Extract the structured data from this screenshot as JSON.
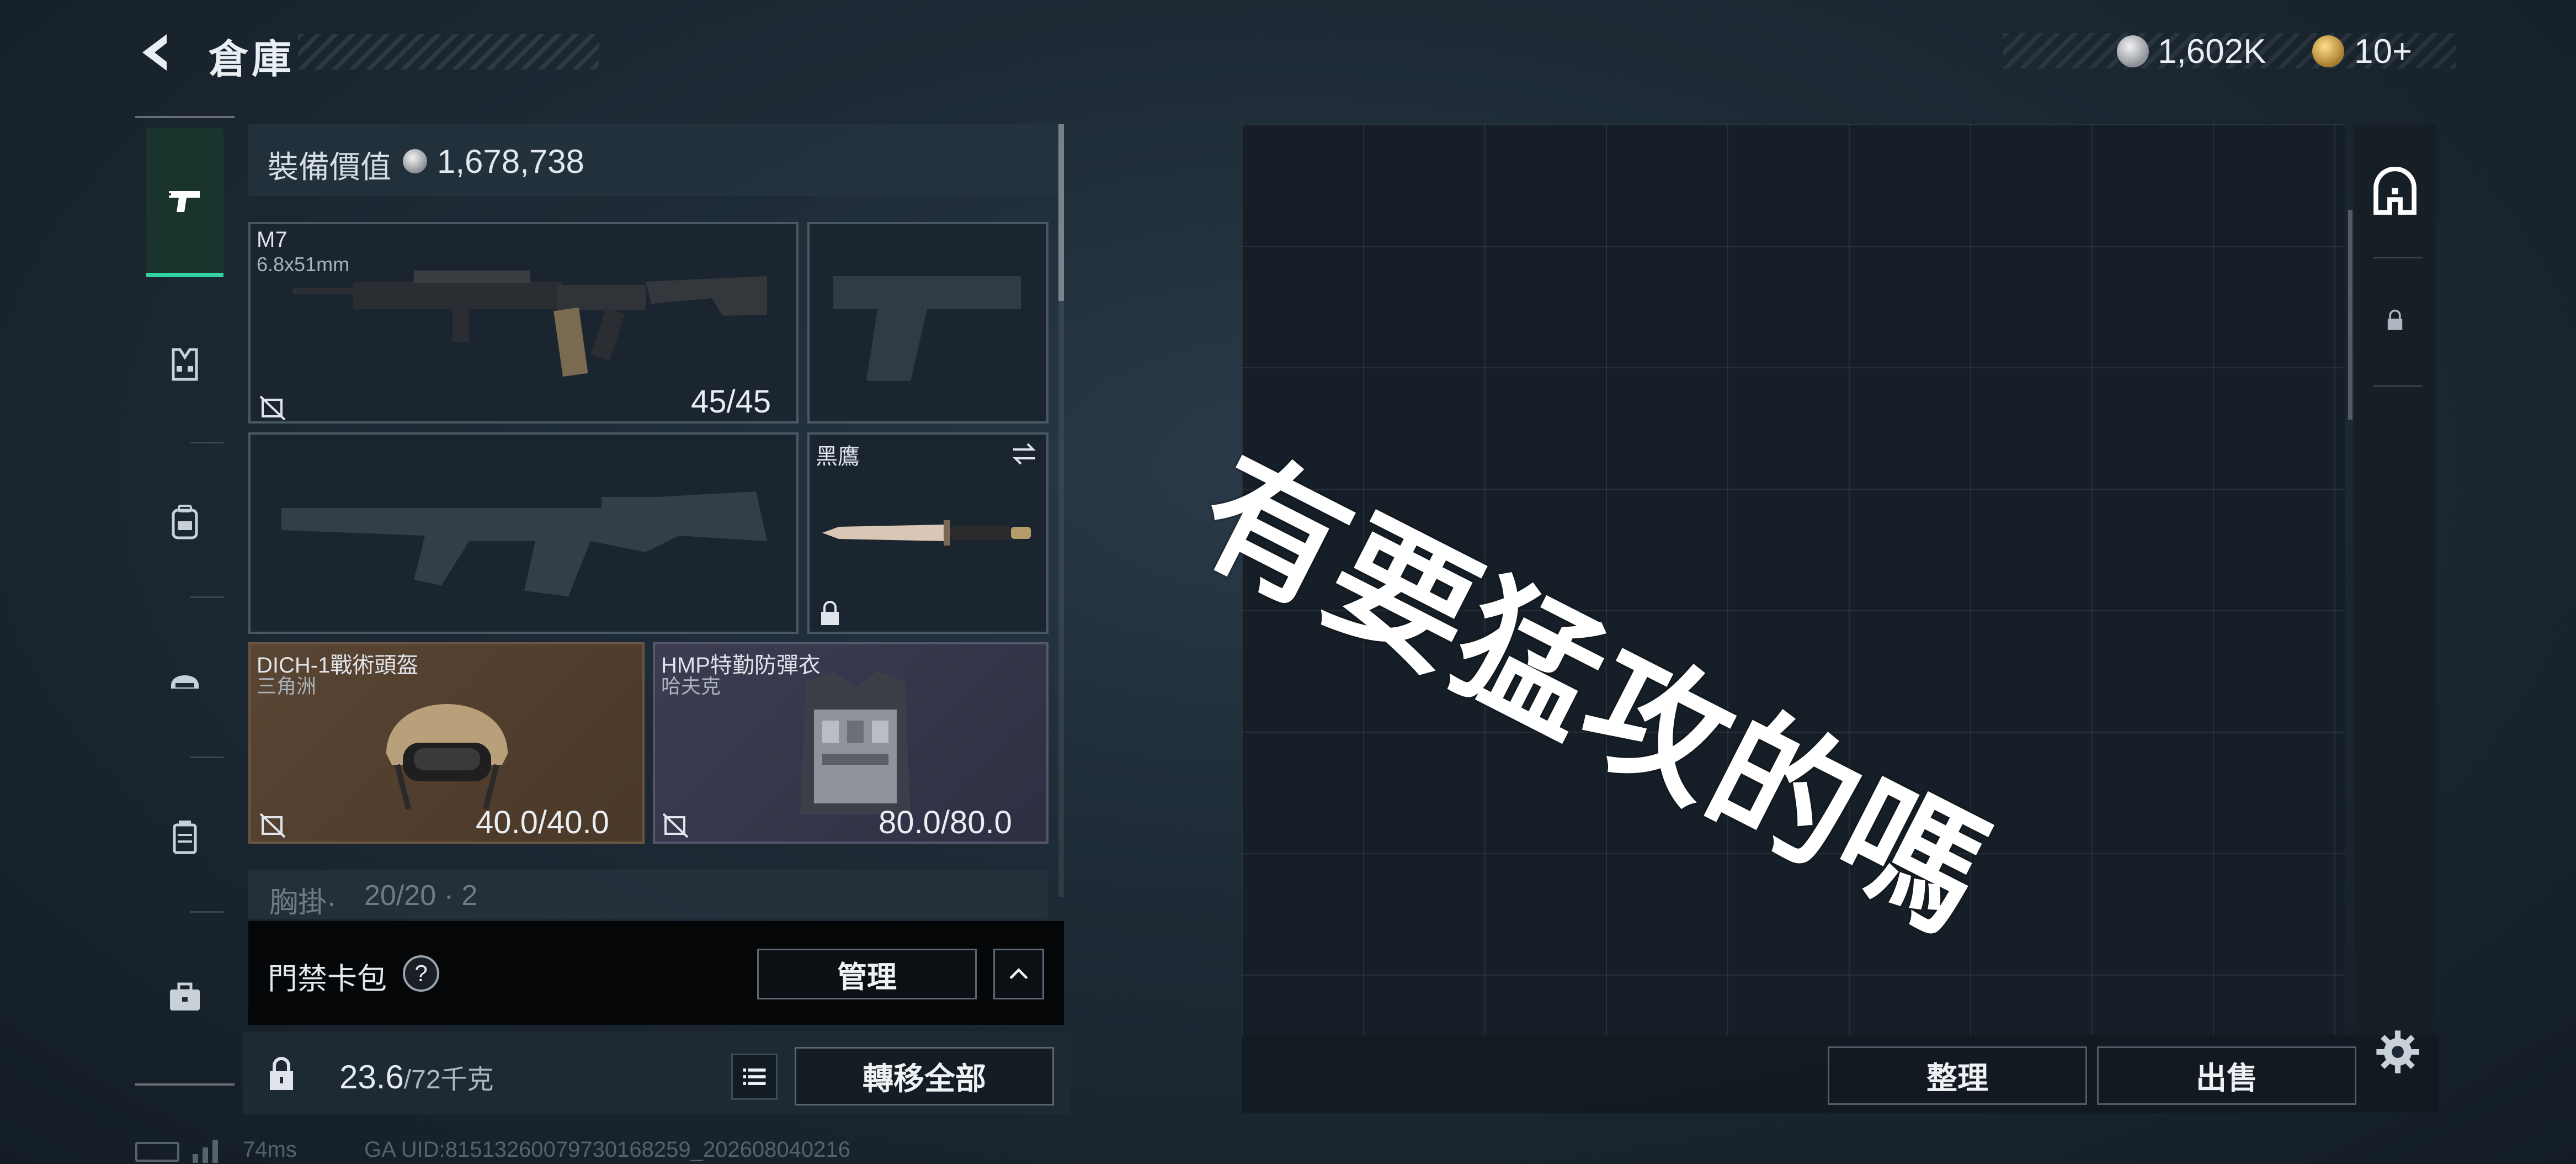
{
  "header": {
    "title": "倉庫",
    "currencies": [
      {
        "icon": "silver-coin-icon",
        "value": "1,602K"
      },
      {
        "icon": "gold-coin-icon",
        "value": "10+"
      }
    ]
  },
  "sidebar": {
    "items": [
      {
        "icon": "pistol-icon",
        "active": true
      },
      {
        "icon": "vest-icon",
        "active": false
      },
      {
        "icon": "backpack-icon",
        "active": false
      },
      {
        "icon": "helmet-icon",
        "active": false
      },
      {
        "icon": "container-icon",
        "active": false
      },
      {
        "icon": "toolbox-icon",
        "active": false
      }
    ]
  },
  "loadout": {
    "value_label": "裝備價值",
    "value": "1,678,738",
    "slots": {
      "primary": {
        "name": "M7",
        "ammo_type": "6.8x51mm",
        "ammo": "45/45"
      },
      "knife": {
        "name": "黑鷹"
      },
      "helmet": {
        "name": "DICH-1戰術頭盔",
        "origin": "三角洲",
        "durability": "40.0/40.0"
      },
      "armor": {
        "name": "HMP特勤防彈衣",
        "origin": "哈夫克",
        "durability": "80.0/80.0"
      },
      "chest_rig": {
        "label": "胸掛·",
        "capacity": "20/20 · 2"
      }
    }
  },
  "keycard": {
    "label": "門禁卡包",
    "help": "?",
    "manage_label": "管理"
  },
  "weight": {
    "current": "23.6",
    "max": "/72千克",
    "transfer_label": "轉移全部"
  },
  "stash": {
    "sort_label": "整理",
    "sell_label": "出售"
  },
  "overlay": {
    "caption": "有要猛攻的嗎"
  },
  "status": {
    "ping": "74ms",
    "uid": "GA UID:81513260079730168259_202608040216"
  },
  "colors": {
    "accent": "#34d1a4",
    "helmet_bg": "#5a4533",
    "armor_bg": "#3c3c52"
  }
}
